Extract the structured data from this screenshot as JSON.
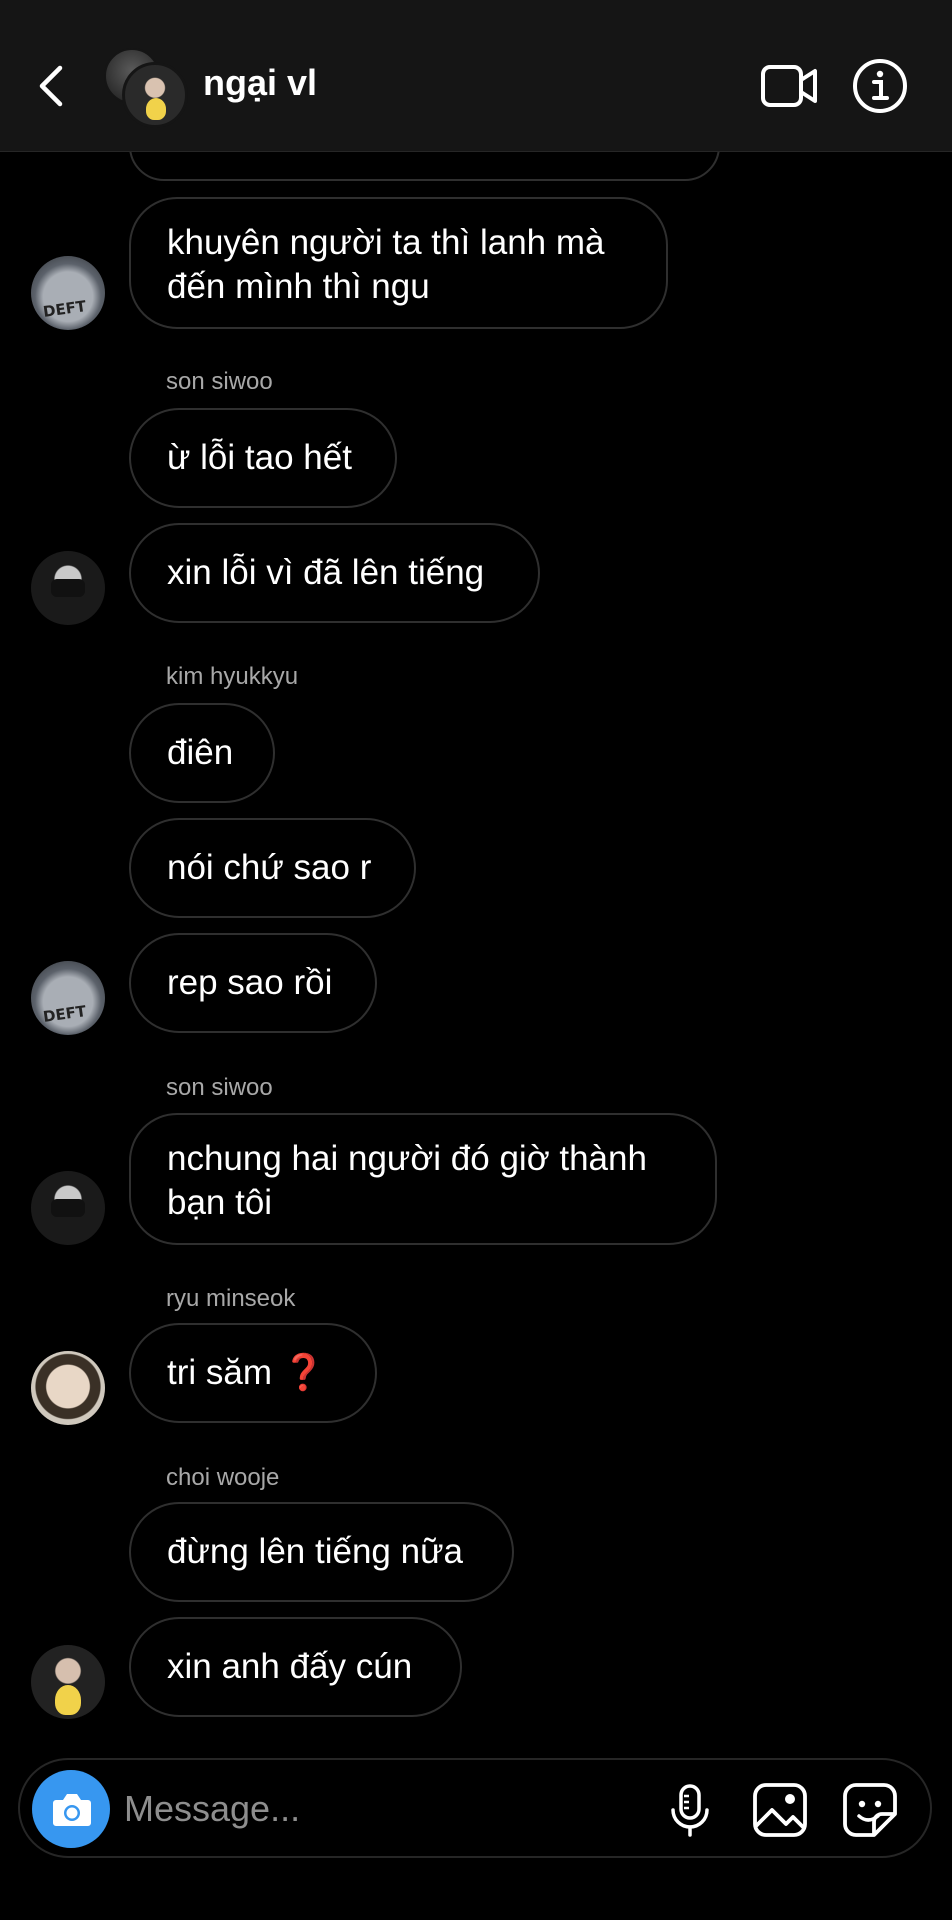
{
  "header": {
    "title": "ngại vl",
    "back_icon": "chevron-left-icon",
    "video_icon": "video-camera-icon",
    "info_icon": "info-icon"
  },
  "messages": [
    {
      "sender": "",
      "text": "khuyên người ta thì lanh mà đến mình thì ngu"
    },
    {
      "sender": "son siwoo",
      "text": "ừ lỗi tao hết"
    },
    {
      "sender": "",
      "text": "xin lỗi vì đã lên tiếng"
    },
    {
      "sender": "kim hyukkyu",
      "text": "điên"
    },
    {
      "sender": "",
      "text": "nói chứ sao r"
    },
    {
      "sender": "",
      "text": "rep sao rồi"
    },
    {
      "sender": "son siwoo",
      "text": "nchung hai người đó giờ thành bạn tôi"
    },
    {
      "sender": "ryu minseok",
      "text": "tri săm ❓"
    },
    {
      "sender": "choi wooje",
      "text": "đừng lên tiếng nữa"
    },
    {
      "sender": "",
      "text": "xin anh đấy cún"
    }
  ],
  "avatars": {
    "deft_print": "DEFT"
  },
  "composer": {
    "placeholder": "Message...",
    "camera_icon": "camera-icon",
    "mic_icon": "microphone-icon",
    "gallery_icon": "image-icon",
    "sticker_icon": "sticker-icon"
  },
  "colors": {
    "background": "#000000",
    "header_bg": "#151515",
    "bubble_border": "#2f2f2f",
    "camera_button": "#3797f0",
    "sender_name": "#a8a8a8"
  }
}
